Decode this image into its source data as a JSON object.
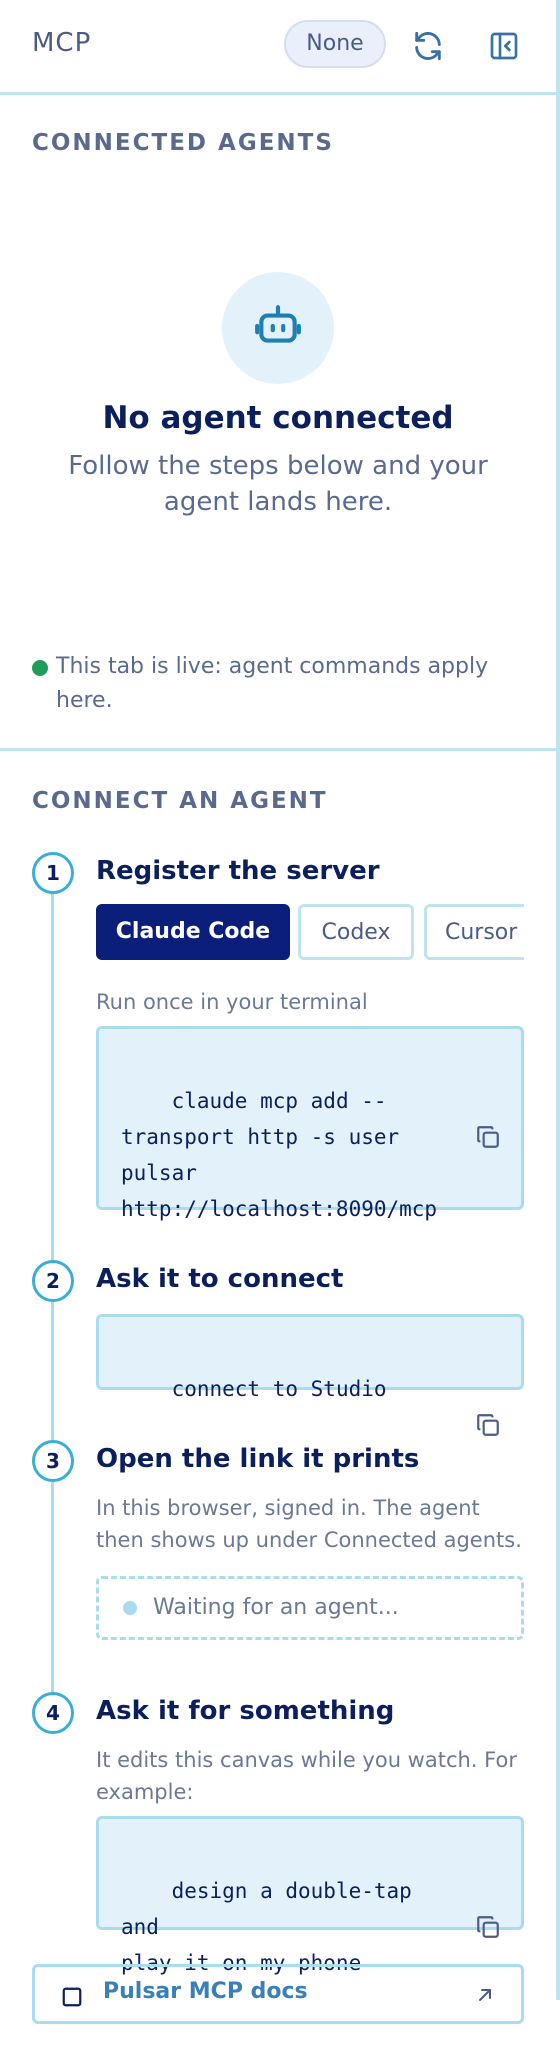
{
  "header": {
    "title": "MCP",
    "selector_value": "None"
  },
  "connected": {
    "heading": "CONNECTED AGENTS",
    "empty_title": "No agent connected",
    "empty_subtitle": "Follow the steps below and your agent lands here.",
    "live_text": "This tab is live: agent commands apply here.",
    "live_color": "#1e9e5a"
  },
  "connect": {
    "heading": "CONNECT AN AGENT",
    "steps": [
      {
        "number": "1",
        "title": "Register the server",
        "tabs": [
          "Claude Code",
          "Codex",
          "Cursor"
        ],
        "active_tab": "Claude Code",
        "hint": "Run once in your terminal",
        "code": "claude mcp add --\ntransport http -s user\npulsar\nhttp://localhost:8090/mcp"
      },
      {
        "number": "2",
        "title": "Ask it to connect",
        "code": "connect to Studio"
      },
      {
        "number": "3",
        "title": "Open the link it prints",
        "hint": "In this browser, signed in. The agent then shows up under Connected agents.",
        "waiting": "Waiting for an agent..."
      },
      {
        "number": "4",
        "title": "Ask it for something",
        "hint": "It edits this canvas while you watch. For example:",
        "code": "design a double-tap and\nplay it on my phone"
      }
    ],
    "docs_link": "Pulsar MCP docs"
  },
  "colors": {
    "accent": "#0b1f7a",
    "border": "#bfe3ef",
    "code_bg": "#e3f2fa"
  }
}
